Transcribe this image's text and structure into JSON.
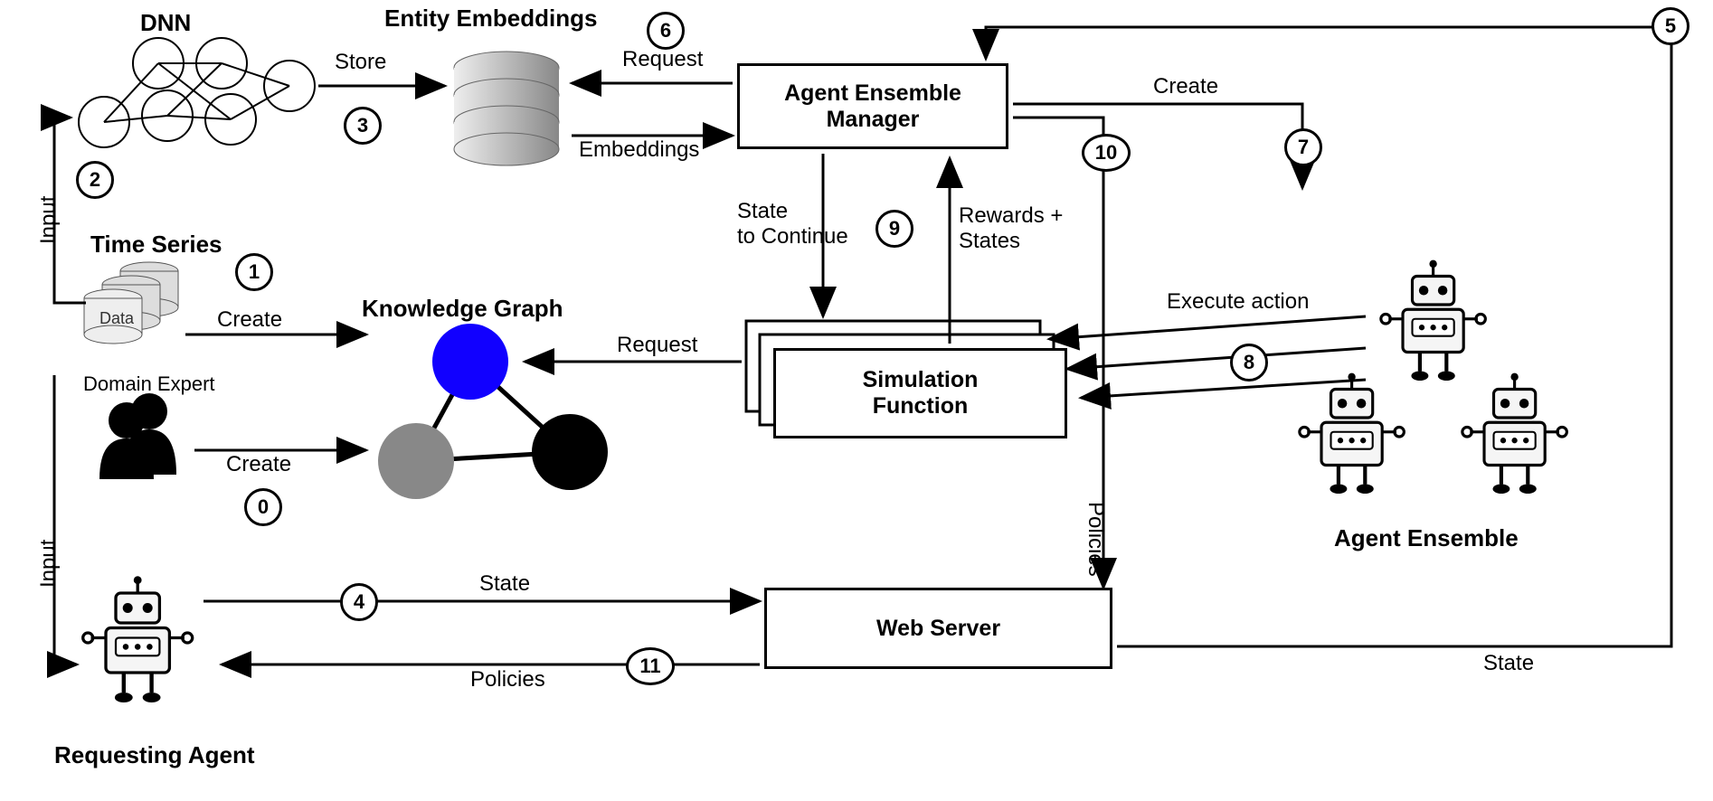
{
  "nodes": {
    "dnn": "DNN",
    "entity_embeddings": "Entity Embeddings",
    "agent_ensemble_manager": "Agent Ensemble\nManager",
    "time_series": "Time Series",
    "time_series_data": "Data",
    "knowledge_graph": "Knowledge Graph",
    "simulation_function": "Simulation\nFunction",
    "domain_expert": "Domain Expert",
    "web_server": "Web Server",
    "requesting_agent": "Requesting Agent",
    "agent_ensemble": "Agent Ensemble"
  },
  "edges": {
    "store": "Store",
    "request_embeddings": "Request",
    "embeddings": "Embeddings",
    "input_dnn": "Input",
    "input_agent": "Input",
    "create_kg_ts": "Create",
    "create_kg_expert": "Create",
    "request_kg": "Request",
    "state_to_continue": "State\nto Continue",
    "rewards_states": "Rewards +\nStates",
    "execute_action": "Execute action",
    "create_ensemble": "Create",
    "policies_to_server": "Policies",
    "state_to_server": "State",
    "policies_out": "Policies",
    "state_from_server": "State"
  },
  "steps": {
    "s0": "0",
    "s1": "1",
    "s2": "2",
    "s3": "3",
    "s4": "4",
    "s5": "5",
    "s6": "6",
    "s7": "7",
    "s8": "8",
    "s9": "9",
    "s10": "10",
    "s11": "11"
  }
}
